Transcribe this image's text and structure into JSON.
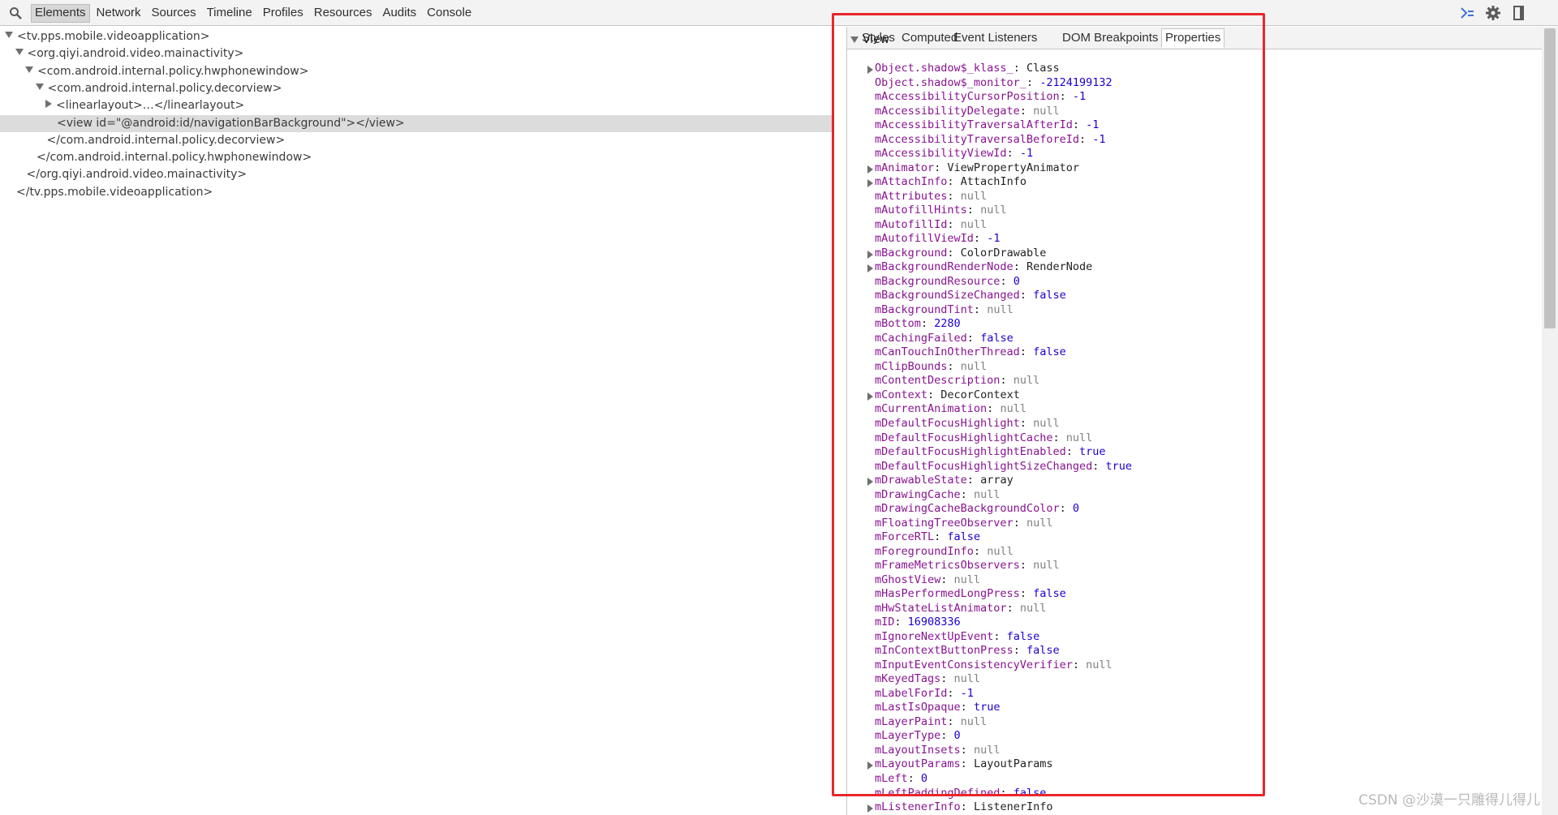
{
  "toolbar": {
    "tabs": [
      "Elements",
      "Network",
      "Sources",
      "Timeline",
      "Profiles",
      "Resources",
      "Audits",
      "Console"
    ],
    "active_tab": "Elements",
    "icons": [
      "console-drawer-icon",
      "gear-icon",
      "dock-icon"
    ]
  },
  "tree": [
    {
      "depth": 0,
      "arrow": "down",
      "text": "<tv.pps.mobile.videoapplication>"
    },
    {
      "depth": 1,
      "arrow": "down",
      "text": "<org.qiyi.android.video.mainactivity>"
    },
    {
      "depth": 2,
      "arrow": "down",
      "text": "<com.android.internal.policy.hwphonewindow>"
    },
    {
      "depth": 3,
      "arrow": "down",
      "text": "<com.android.internal.policy.decorview>"
    },
    {
      "depth": 4,
      "arrow": "right",
      "text": "<linearlayout>…</linearlayout>"
    },
    {
      "depth": 4,
      "arrow": "none",
      "text": "<view id=\"@android:id/navigationBarBackground\"></view>",
      "selected": true
    },
    {
      "depth": 3,
      "arrow": "none",
      "text": "</com.android.internal.policy.decorview>"
    },
    {
      "depth": 2,
      "arrow": "none",
      "text": "</com.android.internal.policy.hwphonewindow>"
    },
    {
      "depth": 1,
      "arrow": "none",
      "text": "</org.qiyi.android.video.mainactivity>"
    },
    {
      "depth": 0,
      "arrow": "none",
      "text": "</tv.pps.mobile.videoapplication>"
    }
  ],
  "sidebar": {
    "tabs": [
      "Styles",
      "Computed",
      "Event Listeners",
      "DOM Breakpoints",
      "Properties"
    ],
    "active_tab": "Properties",
    "section_title": "View",
    "properties": [
      {
        "key": "Object.shadow$_klass_",
        "value": "Class",
        "type": "obj",
        "expandable": true
      },
      {
        "key": "Object.shadow$_monitor_",
        "value": "-2124199132",
        "type": "num"
      },
      {
        "key": "mAccessibilityCursorPosition",
        "value": "-1",
        "type": "num"
      },
      {
        "key": "mAccessibilityDelegate",
        "value": "null",
        "type": "null"
      },
      {
        "key": "mAccessibilityTraversalAfterId",
        "value": "-1",
        "type": "num"
      },
      {
        "key": "mAccessibilityTraversalBeforeId",
        "value": "-1",
        "type": "num"
      },
      {
        "key": "mAccessibilityViewId",
        "value": "-1",
        "type": "num"
      },
      {
        "key": "mAnimator",
        "value": "ViewPropertyAnimator",
        "type": "obj",
        "expandable": true
      },
      {
        "key": "mAttachInfo",
        "value": "AttachInfo",
        "type": "obj",
        "expandable": true
      },
      {
        "key": "mAttributes",
        "value": "null",
        "type": "null"
      },
      {
        "key": "mAutofillHints",
        "value": "null",
        "type": "null"
      },
      {
        "key": "mAutofillId",
        "value": "null",
        "type": "null"
      },
      {
        "key": "mAutofillViewId",
        "value": "-1",
        "type": "num"
      },
      {
        "key": "mBackground",
        "value": "ColorDrawable",
        "type": "obj",
        "expandable": true
      },
      {
        "key": "mBackgroundRenderNode",
        "value": "RenderNode",
        "type": "obj",
        "expandable": true
      },
      {
        "key": "mBackgroundResource",
        "value": "0",
        "type": "num"
      },
      {
        "key": "mBackgroundSizeChanged",
        "value": "false",
        "type": "bool"
      },
      {
        "key": "mBackgroundTint",
        "value": "null",
        "type": "null"
      },
      {
        "key": "mBottom",
        "value": "2280",
        "type": "num"
      },
      {
        "key": "mCachingFailed",
        "value": "false",
        "type": "bool"
      },
      {
        "key": "mCanTouchInOtherThread",
        "value": "false",
        "type": "bool"
      },
      {
        "key": "mClipBounds",
        "value": "null",
        "type": "null"
      },
      {
        "key": "mContentDescription",
        "value": "null",
        "type": "null"
      },
      {
        "key": "mContext",
        "value": "DecorContext",
        "type": "obj",
        "expandable": true
      },
      {
        "key": "mCurrentAnimation",
        "value": "null",
        "type": "null"
      },
      {
        "key": "mDefaultFocusHighlight",
        "value": "null",
        "type": "null"
      },
      {
        "key": "mDefaultFocusHighlightCache",
        "value": "null",
        "type": "null"
      },
      {
        "key": "mDefaultFocusHighlightEnabled",
        "value": "true",
        "type": "bool"
      },
      {
        "key": "mDefaultFocusHighlightSizeChanged",
        "value": "true",
        "type": "bool"
      },
      {
        "key": "mDrawableState",
        "value": "array",
        "type": "obj",
        "expandable": true
      },
      {
        "key": "mDrawingCache",
        "value": "null",
        "type": "null"
      },
      {
        "key": "mDrawingCacheBackgroundColor",
        "value": "0",
        "type": "num"
      },
      {
        "key": "mFloatingTreeObserver",
        "value": "null",
        "type": "null"
      },
      {
        "key": "mForceRTL",
        "value": "false",
        "type": "bool"
      },
      {
        "key": "mForegroundInfo",
        "value": "null",
        "type": "null"
      },
      {
        "key": "mFrameMetricsObservers",
        "value": "null",
        "type": "null"
      },
      {
        "key": "mGhostView",
        "value": "null",
        "type": "null"
      },
      {
        "key": "mHasPerformedLongPress",
        "value": "false",
        "type": "bool"
      },
      {
        "key": "mHwStateListAnimator",
        "value": "null",
        "type": "null"
      },
      {
        "key": "mID",
        "value": "16908336",
        "type": "num"
      },
      {
        "key": "mIgnoreNextUpEvent",
        "value": "false",
        "type": "bool"
      },
      {
        "key": "mInContextButtonPress",
        "value": "false",
        "type": "bool"
      },
      {
        "key": "mInputEventConsistencyVerifier",
        "value": "null",
        "type": "null"
      },
      {
        "key": "mKeyedTags",
        "value": "null",
        "type": "null"
      },
      {
        "key": "mLabelForId",
        "value": "-1",
        "type": "num"
      },
      {
        "key": "mLastIsOpaque",
        "value": "true",
        "type": "bool"
      },
      {
        "key": "mLayerPaint",
        "value": "null",
        "type": "null"
      },
      {
        "key": "mLayerType",
        "value": "0",
        "type": "num"
      },
      {
        "key": "mLayoutInsets",
        "value": "null",
        "type": "null"
      },
      {
        "key": "mLayoutParams",
        "value": "LayoutParams",
        "type": "obj",
        "expandable": true
      },
      {
        "key": "mLeft",
        "value": "0",
        "type": "num"
      },
      {
        "key": "mLeftPaddingDefined",
        "value": "false",
        "type": "bool"
      },
      {
        "key": "mListenerInfo",
        "value": "ListenerInfo",
        "type": "obj",
        "expandable": true
      }
    ]
  },
  "watermark": "CSDN @沙漠一只雕得儿得儿",
  "colors": {
    "highlight_box": "#e8262b",
    "prop_key": "#881391",
    "prop_value": "#1c00cf"
  }
}
